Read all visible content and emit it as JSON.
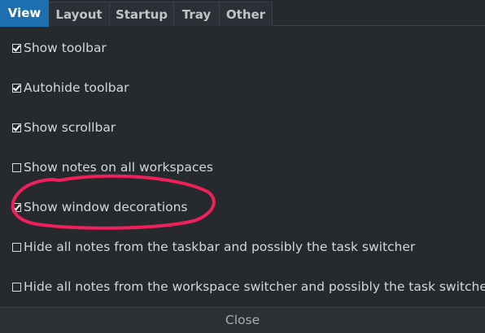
{
  "tabs": [
    {
      "label": "View",
      "active": true
    },
    {
      "label": "Layout",
      "active": false
    },
    {
      "label": "Startup",
      "active": false
    },
    {
      "label": "Tray",
      "active": false
    },
    {
      "label": "Other",
      "active": false
    }
  ],
  "options": [
    {
      "label": "Show toolbar",
      "checked": true
    },
    {
      "label": "Autohide toolbar",
      "checked": true
    },
    {
      "label": "Show scrollbar",
      "checked": true
    },
    {
      "label": "Show notes on all workspaces",
      "checked": false
    },
    {
      "label": "Show window decorations",
      "checked": true
    },
    {
      "label": "Hide all notes from the taskbar and possibly the task switcher",
      "checked": false
    },
    {
      "label": "Hide all notes from the workspace switcher and possibly the task switcher",
      "checked": false
    }
  ],
  "footer": {
    "close_label": "Close"
  },
  "colors": {
    "background": "#262a2f",
    "active_tab": "#1d6fb2",
    "annotation": "#f0205a"
  }
}
